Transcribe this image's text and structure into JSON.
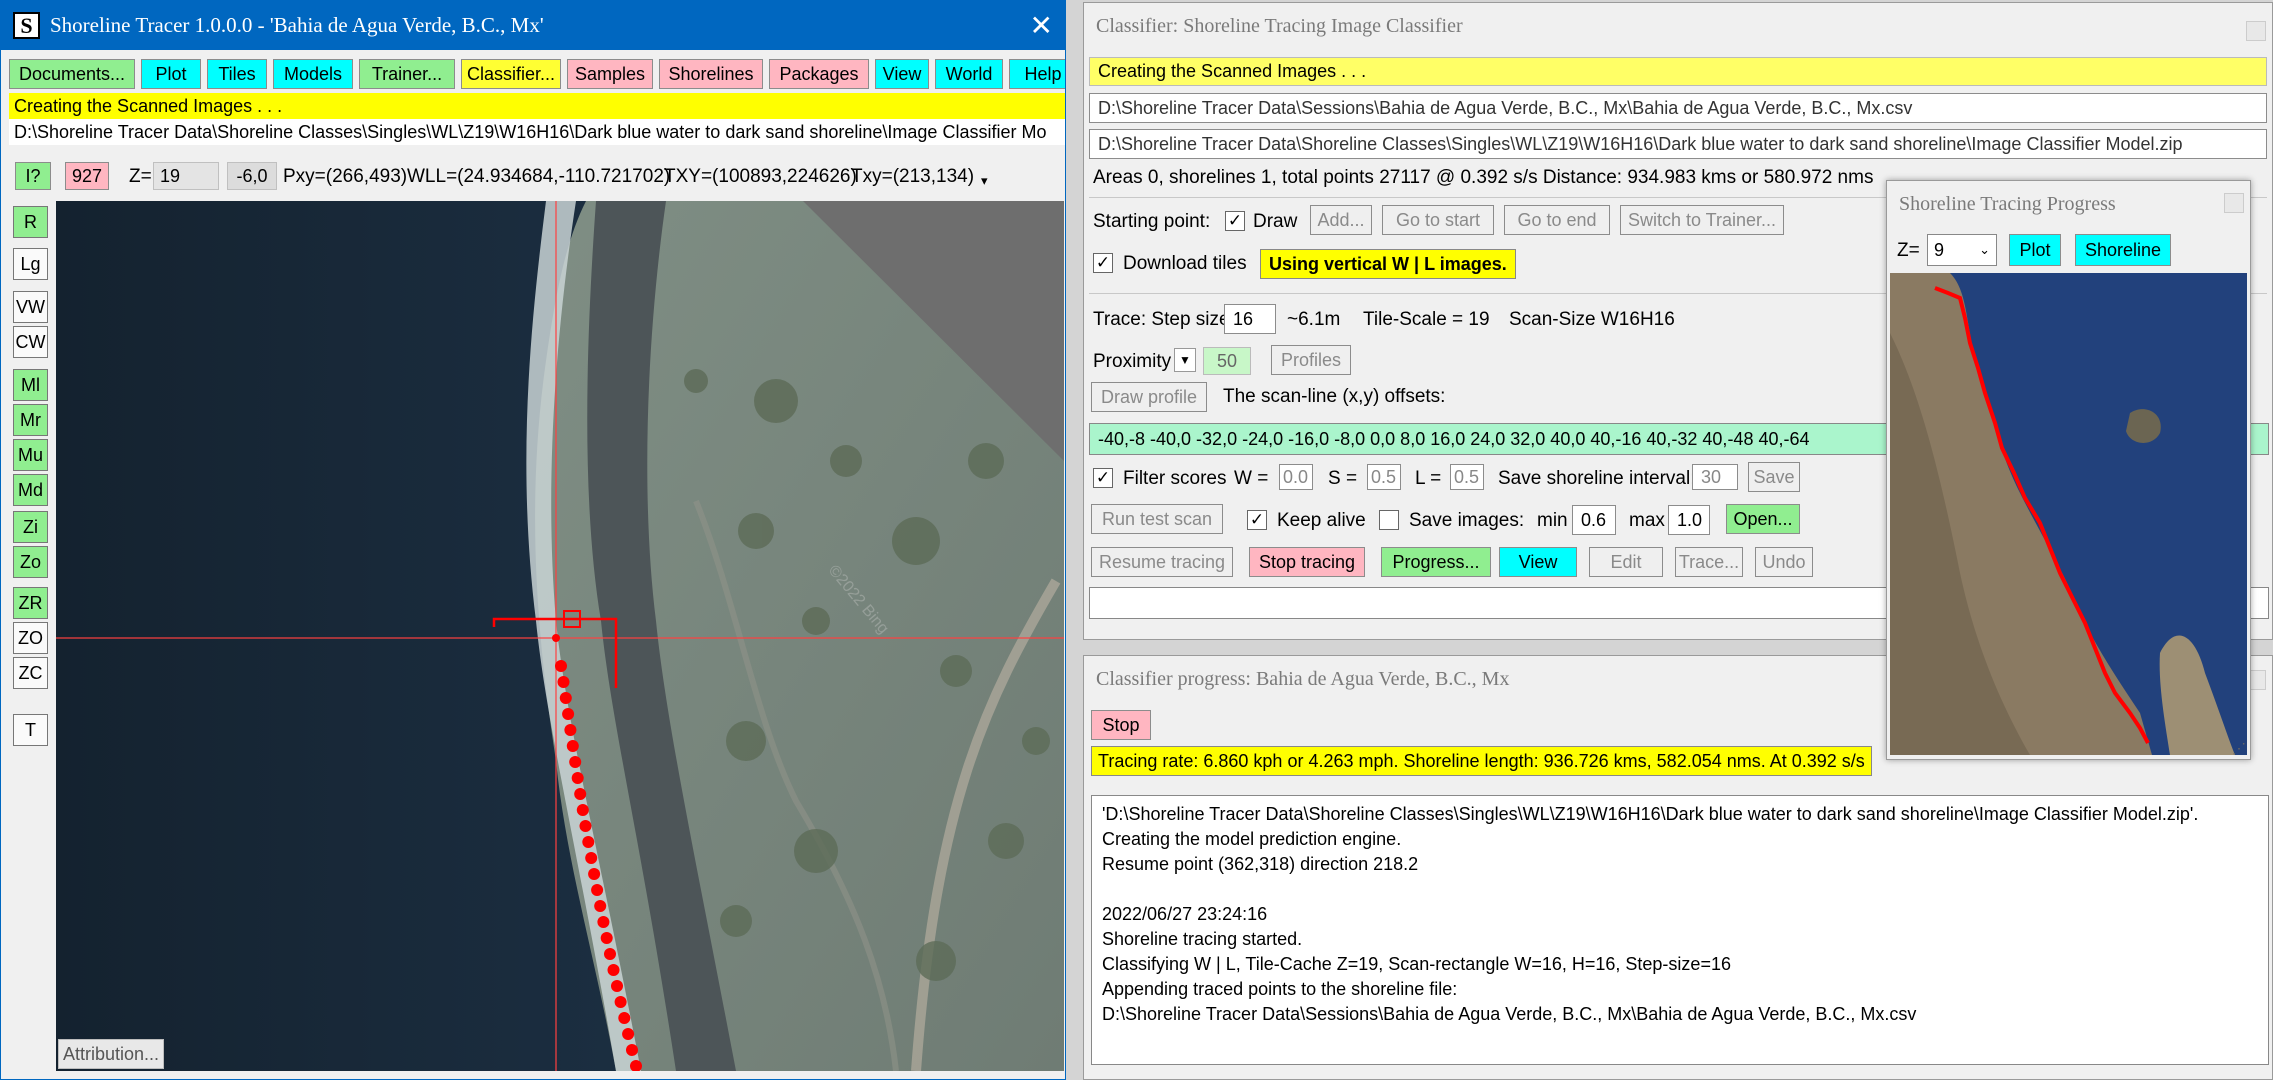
{
  "main_window": {
    "title": "Shoreline Tracer 1.0.0.0 - 'Bahia de Agua Verde, B.C., Mx'",
    "app_icon": "S",
    "menu": [
      "Documents...",
      "Plot",
      "Tiles",
      "Models",
      "Trainer...",
      "Classifier...",
      "Samples",
      "Shorelines",
      "Packages",
      "View",
      "World",
      "Help"
    ],
    "status": "Creating the Scanned Images . . .",
    "path": "D:\\Shoreline Tracer Data\\Shoreline Classes\\Singles\\WL\\Z19\\W16H16\\Dark blue water to dark sand shoreline\\Image Classifier Mo",
    "info_button": "I?",
    "count": "927",
    "zoom_label": "Z=",
    "zoom_value": "19",
    "offset": "-6,0",
    "pxy": "Pxy=(266,493)",
    "wll": "WLL=(24.934684,-110.721702)",
    "txy_upper": "TXY=(100893,224626)",
    "txy_lower": "Txy=(213,134)",
    "side_buttons": [
      "R",
      "Lg",
      "VW",
      "CW",
      "Ml",
      "Mr",
      "Mu",
      "Md",
      "Zi",
      "Zo",
      "ZR",
      "ZO",
      "ZC",
      "T"
    ],
    "attribution": "Attribution...",
    "watermark": "©2022 Bing"
  },
  "classifier_window": {
    "title": "Classifier: Shoreline Tracing Image Classifier",
    "status": "Creating the Scanned Images . . .",
    "session_path": "D:\\Shoreline Tracer Data\\Sessions\\Bahia de Agua Verde, B.C., Mx\\Bahia de Agua Verde, B.C., Mx.csv",
    "model_path": "D:\\Shoreline Tracer Data\\Shoreline Classes\\Singles\\WL\\Z19\\W16H16\\Dark blue water to dark sand shoreline\\Image Classifier Model.zip",
    "summary": "Areas 0, shorelines 1, total points 27117   @ 0.392 s/s   Distance: 934.983 kms or 580.972 nms",
    "starting_point_label": "Starting point:",
    "draw_label": "Draw",
    "add_button": "Add...",
    "go_start": "Go to start",
    "go_end": "Go to end",
    "switch_trainer": "Switch to Trainer...",
    "download_tiles": "Download tiles",
    "vertical_notice": "Using vertical W | L images.",
    "trace_label": "Trace: Step size",
    "step_size": "16",
    "step_approx": "~6.1m",
    "tile_scale": "Tile-Scale = 19",
    "scan_size": "Scan-Size W16H16",
    "proximity_label": "Proximity",
    "proximity_value": "50",
    "profiles_button": "Profiles",
    "draw_profile": "Draw profile",
    "offsets_label": "The scan-line (x,y) offsets:",
    "offsets": "-40,-8 -40,0 -32,0 -24,0 -16,0 -8,0 0,0 8,0 16,0 24,0 32,0 40,0 40,-16 40,-32 40,-48 40,-64",
    "filter_label": "Filter scores",
    "w_label": "W =",
    "w_value": "0.0",
    "s_label": "S =",
    "s_value": "0.5",
    "l_label": "L =",
    "l_value": "0.5",
    "save_interval_label": "Save shoreline interval:",
    "save_interval": "30",
    "save_button": "Save",
    "run_test": "Run test scan",
    "keep_alive": "Keep alive",
    "save_images": "Save images:",
    "min_label": "min",
    "min_value": "0.6",
    "max_label": "max",
    "max_value": "1.0",
    "open_button": "Open...",
    "resume": "Resume tracing",
    "stop_tracing": "Stop tracing",
    "progress": "Progress...",
    "view": "View",
    "edit": "Edit",
    "trace": "Trace...",
    "undo": "Undo"
  },
  "progress_window": {
    "title": "Classifier progress: Bahia de Agua Verde, B.C., Mx",
    "stop_button": "Stop",
    "rate": "Tracing rate: 6.860 kph or 4.263 mph. Shoreline length: 936.726 kms, 582.054 nms. At 0.392 s/s",
    "log": [
      "'D:\\Shoreline Tracer Data\\Shoreline Classes\\Singles\\WL\\Z19\\W16H16\\Dark blue water to dark sand shoreline\\Image Classifier Model.zip'.",
      "Creating the model prediction engine.",
      "Resume point (362,318) direction 218.2",
      "",
      "2022/06/27 23:24:16",
      "Shoreline tracing started.",
      "Classifying W | L, Tile-Cache Z=19, Scan-rectangle W=16, H=16, Step-size=16",
      "Appending traced points to the shoreline file:",
      "D:\\Shoreline Tracer Data\\Sessions\\Bahia de Agua Verde, B.C., Mx\\Bahia de Agua Verde, B.C., Mx.csv"
    ]
  },
  "tracing_progress_window": {
    "title": "Shoreline Tracing Progress",
    "zoom_label": "Z=",
    "zoom_value": "9",
    "plot_button": "Plot",
    "shoreline_button": "Shoreline"
  },
  "colors": {
    "green": "#90ee90",
    "cyan": "#00ffff",
    "pink": "#ffb6c1",
    "yellow": "#ffff33",
    "titlebar_blue": "#0067c0",
    "trace_red": "#ff0000"
  }
}
